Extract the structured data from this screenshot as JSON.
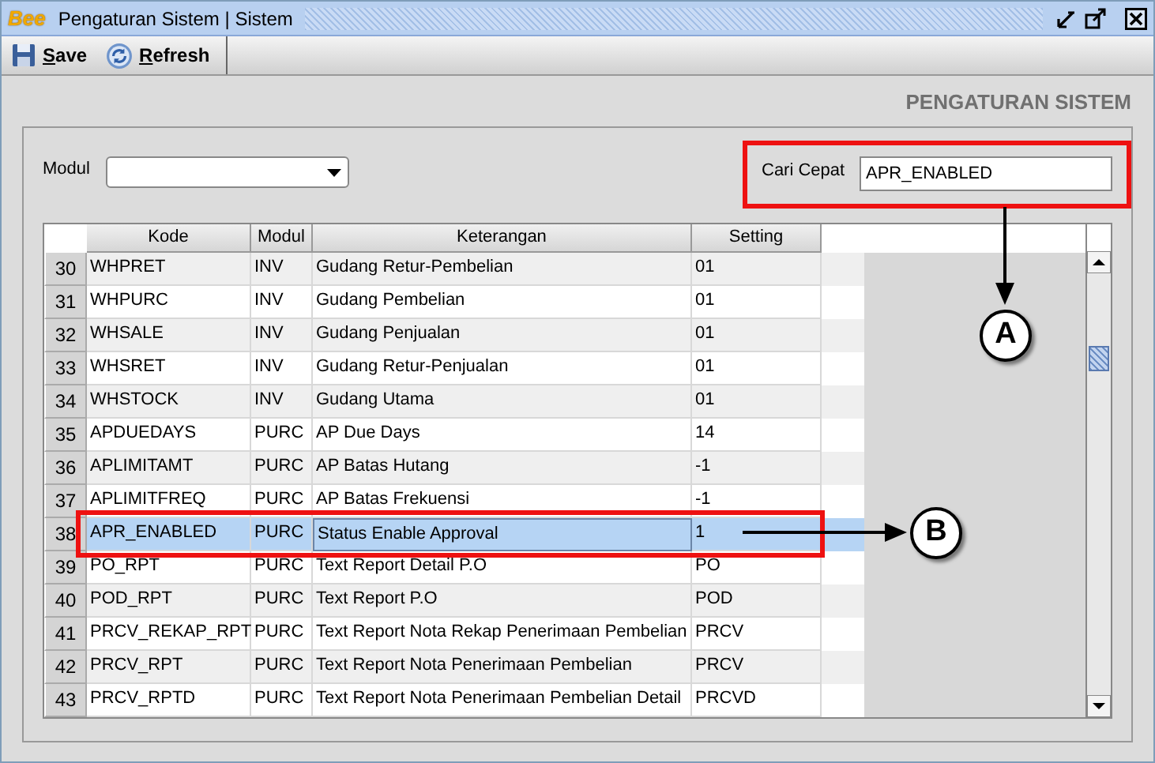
{
  "window": {
    "logo": "Bee",
    "title": "Pengaturan Sistem | Sistem"
  },
  "toolbar": [
    {
      "kind": "save",
      "label": "Save"
    },
    {
      "kind": "refresh",
      "label": "Refresh"
    }
  ],
  "page_title": "PENGATURAN SISTEM",
  "filter": {
    "label": "Modul"
  },
  "quick_search": {
    "label": "Cari Cepat",
    "value": "APR_ENABLED"
  },
  "table": {
    "columns": [
      "Kode",
      "Modul",
      "Keterangan",
      "Setting"
    ],
    "rows": [
      {
        "no": "30",
        "kode": "WHPRET",
        "modul": "INV",
        "keterangan": "Gudang Retur-Pembelian",
        "setting": "01",
        "selected": false
      },
      {
        "no": "31",
        "kode": "WHPURC",
        "modul": "INV",
        "keterangan": "Gudang Pembelian",
        "setting": "01",
        "selected": false
      },
      {
        "no": "32",
        "kode": "WHSALE",
        "modul": "INV",
        "keterangan": "Gudang Penjualan",
        "setting": "01",
        "selected": false
      },
      {
        "no": "33",
        "kode": "WHSRET",
        "modul": "INV",
        "keterangan": "Gudang Retur-Penjualan",
        "setting": "01",
        "selected": false
      },
      {
        "no": "34",
        "kode": "WHSTOCK",
        "modul": "INV",
        "keterangan": "Gudang Utama",
        "setting": "01",
        "selected": false
      },
      {
        "no": "35",
        "kode": "APDUEDAYS",
        "modul": "PURC",
        "keterangan": "AP Due Days",
        "setting": "14",
        "selected": false
      },
      {
        "no": "36",
        "kode": "APLIMITAMT",
        "modul": "PURC",
        "keterangan": "AP Batas Hutang",
        "setting": "-1",
        "selected": false
      },
      {
        "no": "37",
        "kode": "APLIMITFREQ",
        "modul": "PURC",
        "keterangan": "AP Batas Frekuensi",
        "setting": "-1",
        "selected": false
      },
      {
        "no": "38",
        "kode": "APR_ENABLED",
        "modul": "PURC",
        "keterangan": "Status Enable Approval",
        "setting": "1",
        "selected": true
      },
      {
        "no": "39",
        "kode": "PO_RPT",
        "modul": "PURC",
        "keterangan": "Text Report Detail P.O",
        "setting": "PO",
        "selected": false
      },
      {
        "no": "40",
        "kode": "POD_RPT",
        "modul": "PURC",
        "keterangan": "Text Report P.O",
        "setting": "POD",
        "selected": false
      },
      {
        "no": "41",
        "kode": "PRCV_REKAP_RPT",
        "modul": "PURC",
        "keterangan": "Text Report Nota Rekap Penerimaan Pembelian",
        "setting": "PRCV",
        "selected": false
      },
      {
        "no": "42",
        "kode": "PRCV_RPT",
        "modul": "PURC",
        "keterangan": "Text Report Nota Penerimaan Pembelian",
        "setting": "PRCV",
        "selected": false
      },
      {
        "no": "43",
        "kode": "PRCV_RPTD",
        "modul": "PURC",
        "keterangan": "Text Report Nota Penerimaan Pembelian Detail",
        "setting": "PRCVD",
        "selected": false
      }
    ]
  },
  "annotations": [
    {
      "label": "A"
    },
    {
      "label": "B"
    }
  ]
}
